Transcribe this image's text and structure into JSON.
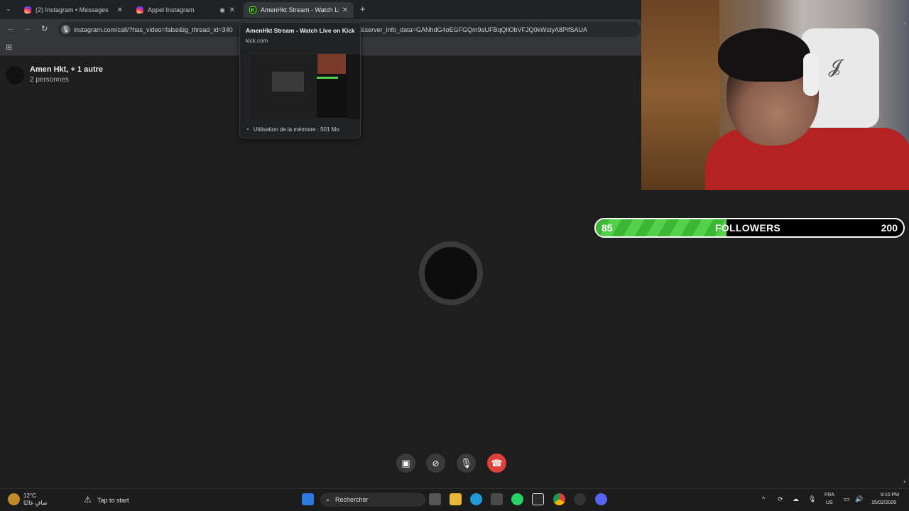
{
  "browser": {
    "tabs": [
      {
        "label": "(2) Instagram • Messages",
        "active": false
      },
      {
        "label": "Appel Instagram",
        "active": false
      },
      {
        "label": "AmenHkt Stream - Watch Live",
        "active": true
      }
    ],
    "new_tab": "+",
    "url": "instagram.com/call/?has_video=false&ig_thread_id=340",
    "url_tail": "74&server_info_data=GANhdG4oEGFGQm9aUFBqQllObVFJQ0kWstyA8PlfSAUA"
  },
  "hovercard": {
    "title": "AmenHkt Stream - Watch Live on Kick",
    "domain": "kick.com",
    "memory": "Utilisation de la mémoire : 501 Mo"
  },
  "call": {
    "title": "Amen Hkt, + 1 autre",
    "subtitle": "2 personnes"
  },
  "followers": {
    "current": "85",
    "label": "FOLLOWERS",
    "goal": "200",
    "progress": 0.425
  },
  "taskbar": {
    "weather_temp": "12°C",
    "weather_desc": "صافٍ غالبًا",
    "tap_to_start": "Tap to start",
    "search": "Rechercher",
    "lang": "FRA",
    "region": "US",
    "time": "9:10 PM",
    "date": "15/02/2026"
  },
  "colors": {
    "kick_green": "#53fc18",
    "progress_green": "#53d14a",
    "end_call_red": "#e0403a"
  }
}
